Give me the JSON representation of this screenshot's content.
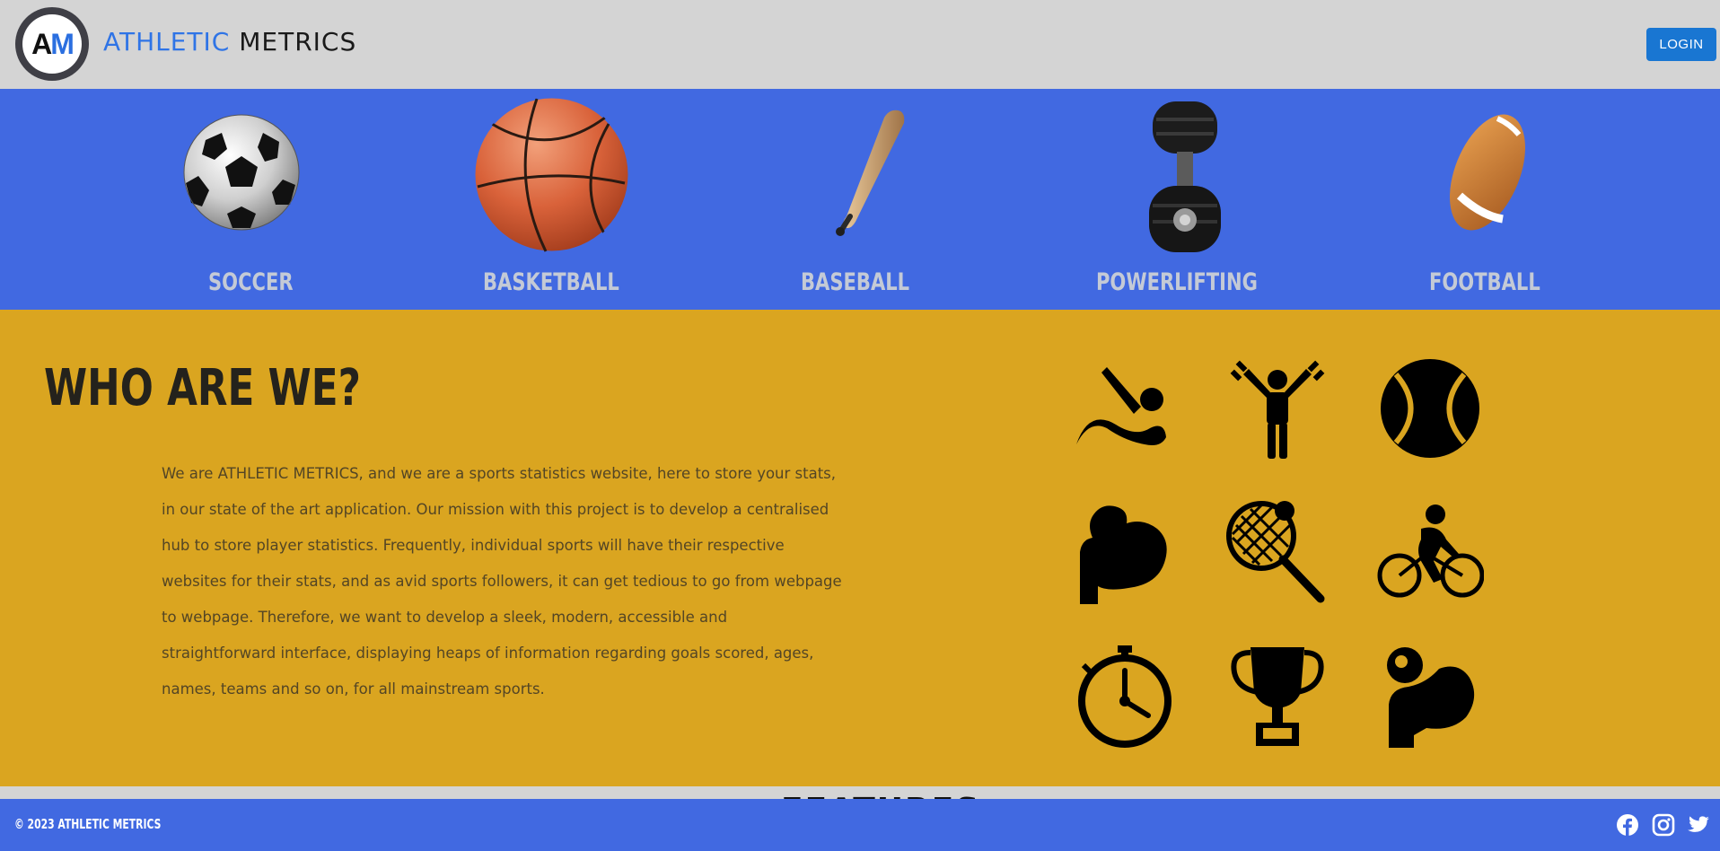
{
  "header": {
    "logo_letter_a": "A",
    "logo_letter_m": "M",
    "brand_first": "ATHLETIC",
    "brand_second": "METRICS",
    "login_label": "LOGIN"
  },
  "sports": [
    {
      "label": "SOCCER",
      "icon": "soccer-ball"
    },
    {
      "label": "BASKETBALL",
      "icon": "basketball"
    },
    {
      "label": "BASEBALL",
      "icon": "baseball-bat"
    },
    {
      "label": "POWERLIFTING",
      "icon": "dumbbell"
    },
    {
      "label": "FOOTBALL",
      "icon": "american-football"
    }
  ],
  "about": {
    "title": "WHO ARE WE?",
    "text": "We are ATHLETIC METRICS, and we are a sports statistics website, here to store your stats, in our state of the art application. Our mission with this project is to develop a centralised hub to store player statistics. Frequently, individual sports will have their respective websites for their stats, and as avid sports followers, it can get tedious to go from webpage to webpage. Therefore, we want to develop a sleek, modern, accessible and straightforward interface, displaying heaps of information regarding goals scored, ages, names, teams and so on, for all mainstream sports.",
    "icons": [
      "swimmer-icon",
      "weightlifter-icon",
      "tennis-ball-icon",
      "flexed-arm-icon",
      "tennis-racket-icon",
      "cyclist-icon",
      "stopwatch-icon",
      "trophy-icon",
      "strongman-icon"
    ]
  },
  "features": {
    "title": "FEATURES"
  },
  "footer": {
    "copyright": "© 2023 ATHLETIC METRICS",
    "social": [
      "facebook-icon",
      "instagram-icon",
      "twitter-icon"
    ]
  },
  "colors": {
    "header_bg": "#d4d4d4",
    "sports_band": "#4169e1",
    "about_bg": "#daa520",
    "login_button": "#1976d2",
    "brand_accent": "#2f74e6"
  }
}
